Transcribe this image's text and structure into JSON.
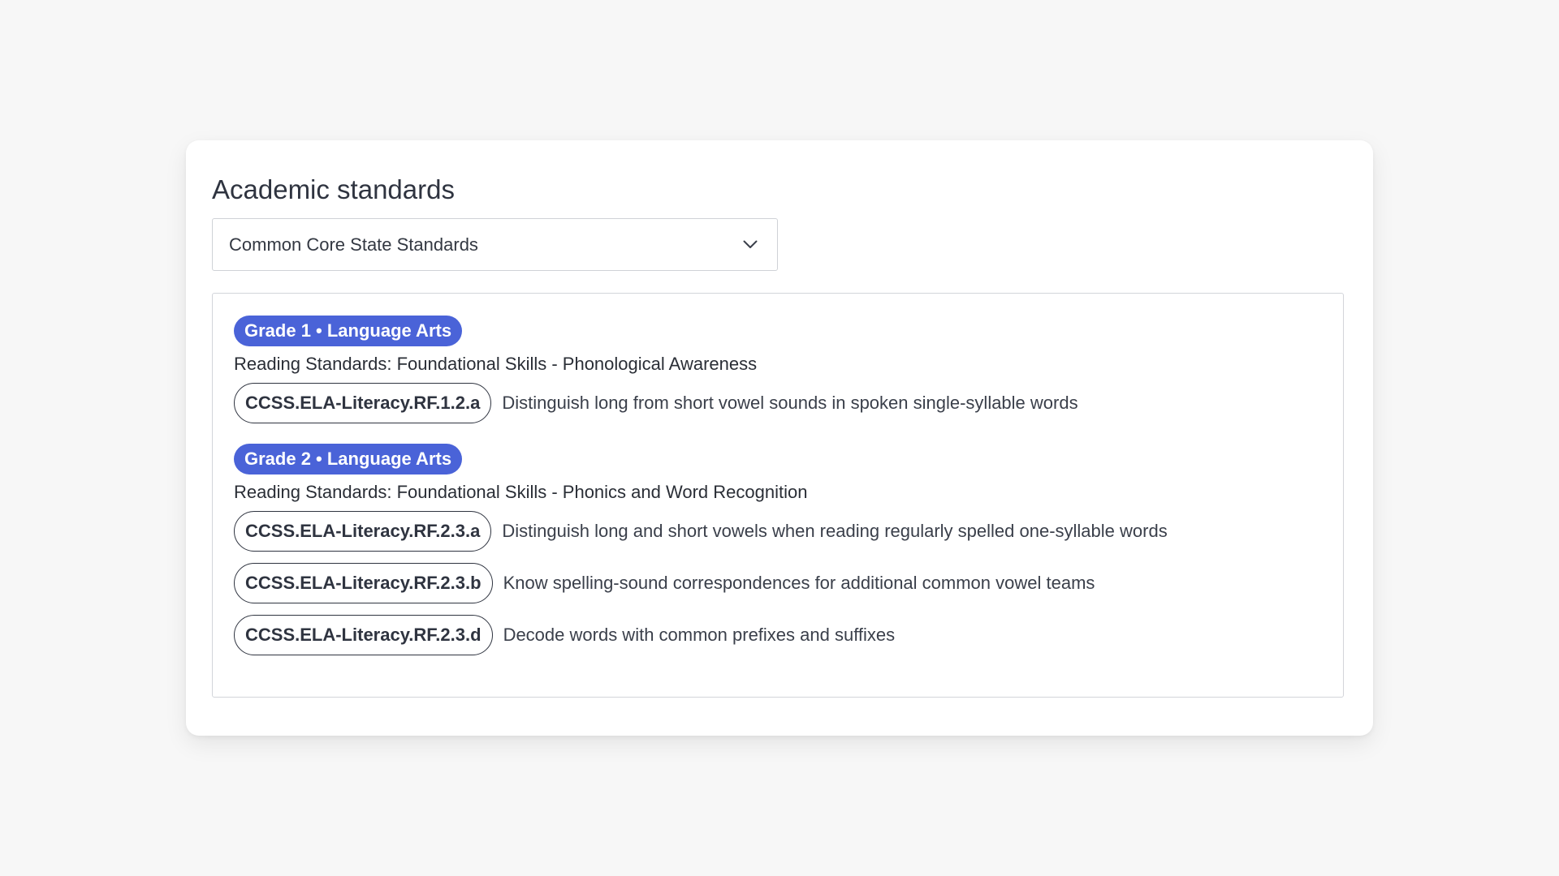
{
  "card": {
    "title": "Academic standards"
  },
  "select": {
    "value": "Common Core State Standards",
    "icon": "chevron-down-icon"
  },
  "colors": {
    "badge_bg": "#4a63d8",
    "badge_text": "#ffffff",
    "page_bg": "#f7f7f7"
  },
  "groups": [
    {
      "badge": "Grade 1 • Language Arts",
      "domain": "Reading Standards: Foundational Skills - Phonological Awareness",
      "standards": [
        {
          "code": "CCSS.ELA-Literacy.RF.1.2.a",
          "description": "Distinguish long from short vowel sounds in spoken single-syllable words"
        }
      ]
    },
    {
      "badge": "Grade 2 • Language Arts",
      "domain": "Reading Standards: Foundational Skills - Phonics and Word Recognition",
      "standards": [
        {
          "code": "CCSS.ELA-Literacy.RF.2.3.a",
          "description": "Distinguish long and short vowels when reading regularly spelled one-syllable words"
        },
        {
          "code": "CCSS.ELA-Literacy.RF.2.3.b",
          "description": "Know spelling-sound correspondences for additional common vowel teams"
        },
        {
          "code": "CCSS.ELA-Literacy.RF.2.3.d",
          "description": "Decode words with common prefixes and suffixes"
        }
      ]
    }
  ]
}
